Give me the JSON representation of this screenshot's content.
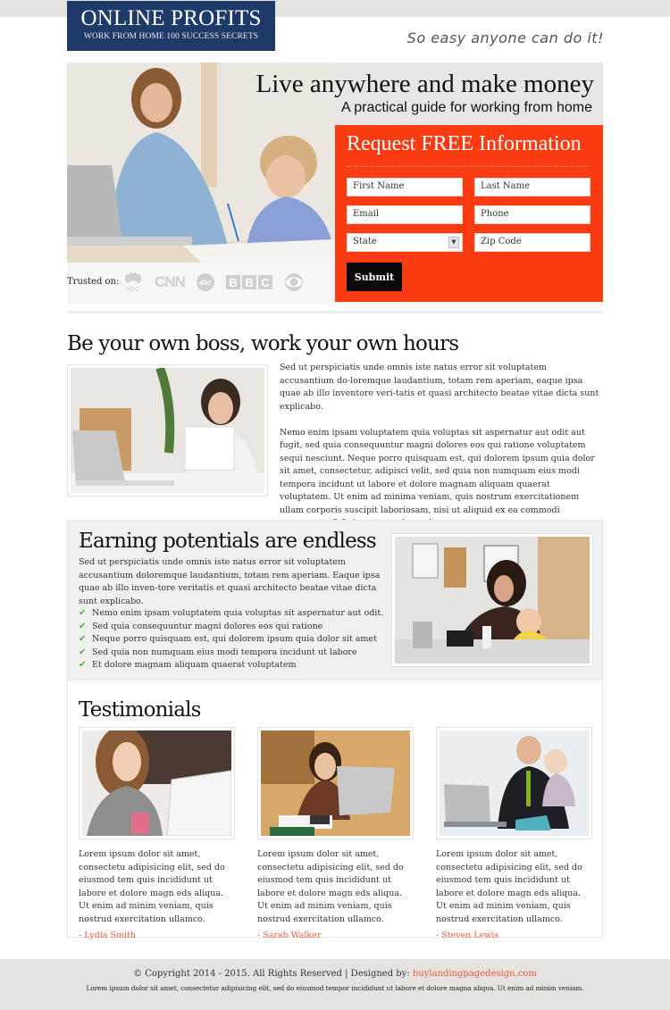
{
  "header": {
    "logo_title": "ONLINE PROFITS",
    "logo_subtitle": "WORK FROM HOME 100 SUCCESS SECRETS",
    "tagline": "So easy anyone can do it!"
  },
  "hero": {
    "title": "Live anywhere and make money",
    "subtitle": "A practical guide for working from home",
    "trusted_label": "Trusted on:",
    "trusted_logos": [
      "NBC",
      "CNN",
      "abc",
      "BBC",
      "CBS"
    ]
  },
  "form": {
    "title": "Request FREE Information",
    "first_name_placeholder": "First Name",
    "last_name_placeholder": "Last Name",
    "email_placeholder": "Email",
    "phone_placeholder": "Phone",
    "state_selected": "State",
    "zip_placeholder": "Zip Code",
    "submit_label": "Submit",
    "accent_color": "#fb3c13"
  },
  "section_boss": {
    "title": "Be your own boss, work your own hours",
    "paragraphs": [
      "Sed ut perspiciatis unde omnis iste natus error sit voluptatem accusantium do-loremque laudantium, totam rem aperiam, eaque ipsa quae ab illo inventore veri-tatis et quasi architecto beatae vitae dicta sunt explicabo.",
      "Nemo enim ipsam voluptatem quia voluptas sit aspernatur aut odit aut fugit, sed quia consequuntur magni dolores eos qui ratione voluptatem sequi nesciunt. Neque porro quisquam est, qui dolorem ipsum quia dolor sit amet, consectetur, adipisci velit, sed quia non numquam eius modi tempora incidunt ut labore et dolore magnam aliquam quaerat voluptatem. Ut enim ad minima veniam, quis nostrum exercitationem ullam corporis suscipit laboriosam, nisi ut aliquid ex ea commodi consequatur? Quis autem vel eum iure."
    ]
  },
  "section_earning": {
    "title": "Earning potentials are endless",
    "text": "Sed ut perspiciatis unde omnis iste natus error sit voluptatem accusantium doloremque laudantium, totam rem aperiam. Eaque ipsa quae ab illo inven-tore veritatis et quasi architecto beatae vitae dicta sunt explicabo.",
    "bullets": [
      "Nemo enim ipsam voluptatem quia voluptas sit aspernatur aut odit.",
      "Sed quia consequuntur magni dolores eos qui ratione",
      "Neque porro quisquam est, qui dolorem ipsum quia dolor sit amet",
      "Sed quia non numquam eius modi tempora incidunt ut labore",
      "Et dolore magnam aliquam quaerat voluptatem"
    ],
    "bullet_icon": "check-icon",
    "bullet_color": "#55a84a"
  },
  "testimonials": {
    "title": "Testimonials",
    "items": [
      {
        "text": "Lorem ipsum dolor sit amet, consectetu adipisicing elit, sed do eiusmod tem quis incididunt ut labore et dolore magn eds aliqua. Ut enim ad minim veniam, quis nostrud exercitation ullamco.",
        "name": "- Lydia Smith"
      },
      {
        "text": "Lorem ipsum dolor sit amet, consectetu adipisicing elit, sed do eiusmod tem quis incididunt ut labore et dolore magn eds aliqua. Ut enim ad minim veniam, quis nostrud exercitation ullamco.",
        "name": "- Sarah Walker"
      },
      {
        "text": "Lorem ipsum dolor sit amet, consectetu adipisicing elit, sed do eiusmod tem quis incididunt ut labore et dolore magn eds aliqua. Ut enim ad minim veniam, quis nostrud exercitation ullamco.",
        "name": "- Steven Lewis"
      }
    ],
    "name_color": "#f25a3a"
  },
  "footer": {
    "copyright": "© Copyright 2014 - 2015. All Rights Reserved  |  Designed by: ",
    "designer_link": "buylandingpagedesign.com",
    "disclaimer": "Lorem ipsum dolor sit amet, consectetur adipisicing elit, sed do eiusmod tempor incididunt ut labore et dolore magna aliqua. Ut enim ad minim veniam."
  }
}
